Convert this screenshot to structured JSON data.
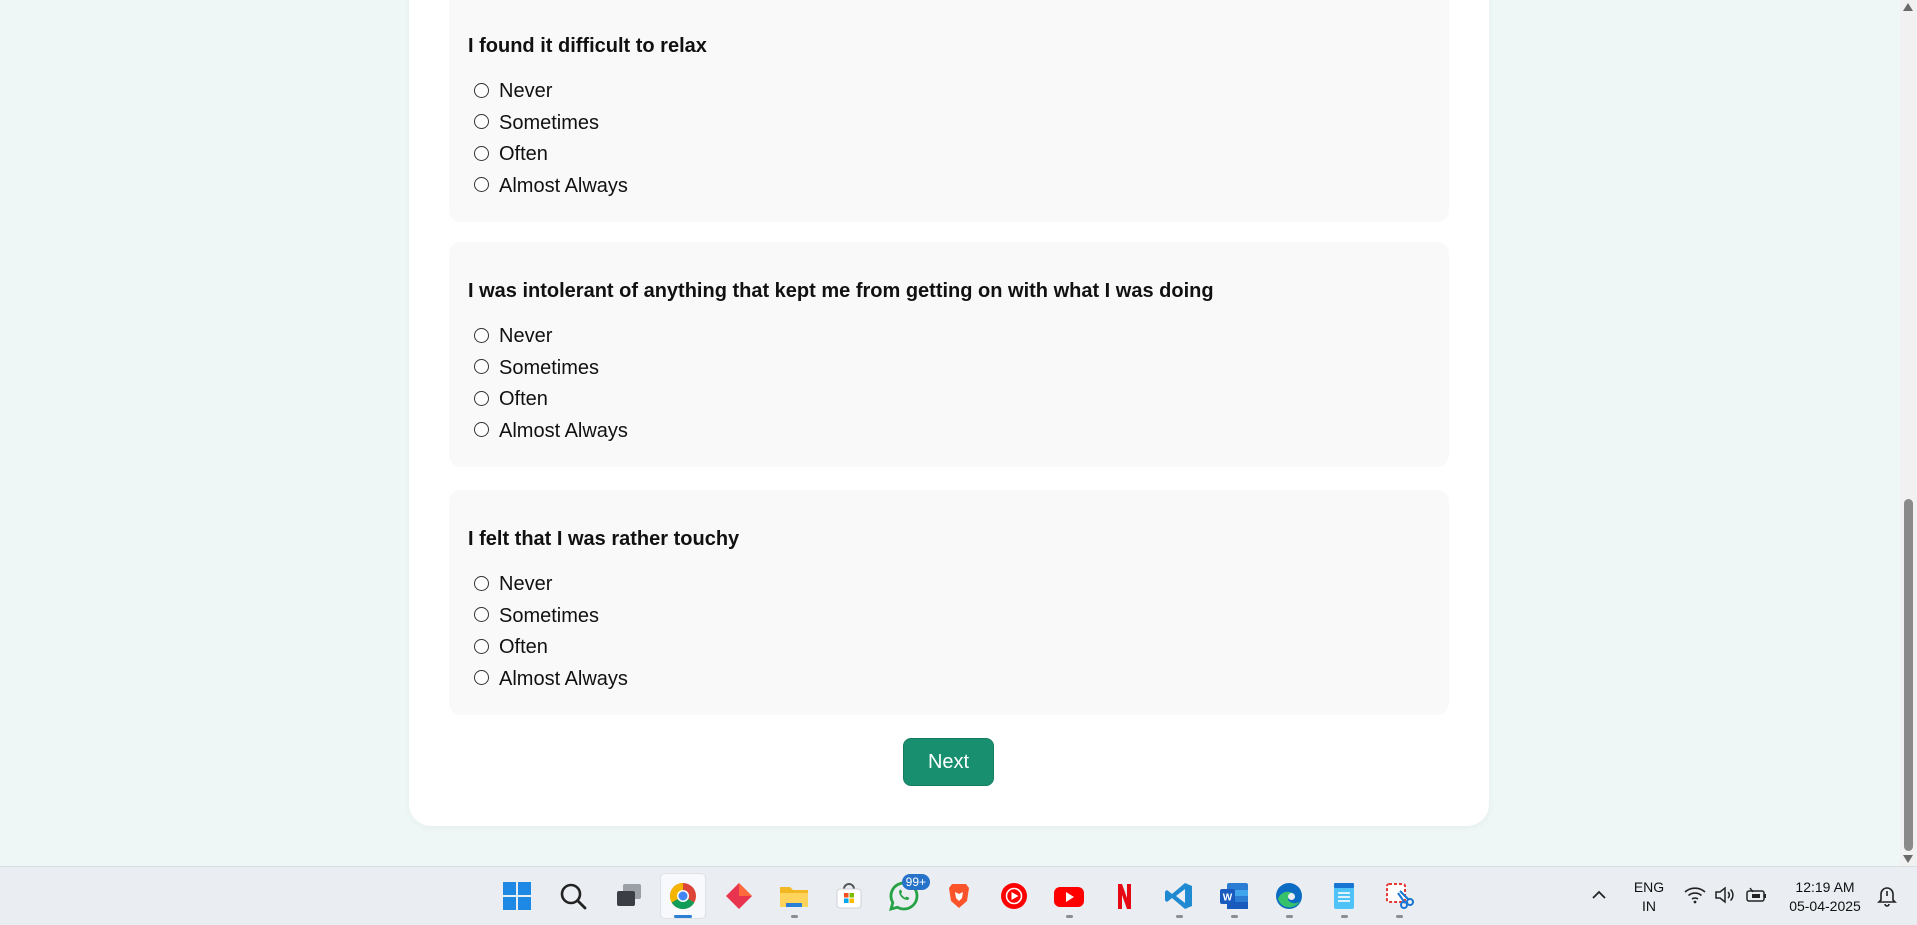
{
  "questions": [
    {
      "title": "I found it difficult to relax",
      "options": [
        "Never",
        "Sometimes",
        "Often",
        "Almost Always"
      ]
    },
    {
      "title": "I was intolerant of anything that kept me from getting on with what I was doing",
      "options": [
        "Never",
        "Sometimes",
        "Often",
        "Almost Always"
      ]
    },
    {
      "title": "I felt that I was rather touchy",
      "options": [
        "Never",
        "Sometimes",
        "Often",
        "Almost Always"
      ]
    }
  ],
  "next_label": "Next",
  "colors": {
    "page_bg": "#eef7f6",
    "card_bg": "#ffffff",
    "question_bg": "#f9f9f9",
    "accent": "#188f6e"
  },
  "taskbar": {
    "whatsapp_badge": "99+",
    "language_line1": "ENG",
    "language_line2": "IN",
    "time": "12:19 AM",
    "date": "05-04-2025"
  }
}
